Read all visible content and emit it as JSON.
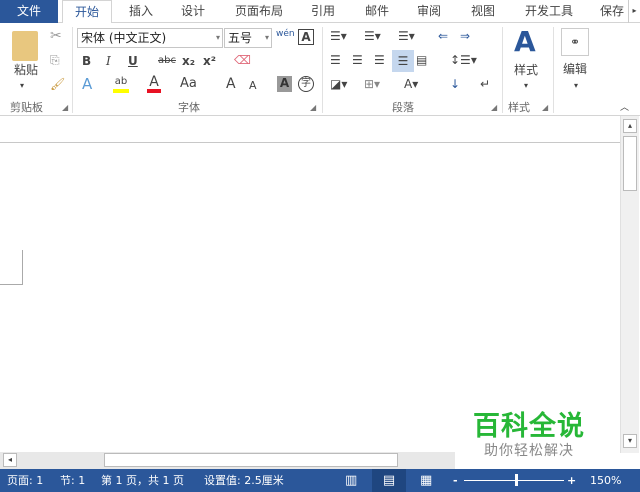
{
  "tabs": [
    "文件",
    "开始",
    "插入",
    "设计",
    "页面布局",
    "引用",
    "邮件",
    "审阅",
    "视图",
    "开发工具",
    "保存"
  ],
  "clipboard": {
    "paste": "粘贴",
    "label": "剪贴板"
  },
  "font": {
    "name": "宋体 (中文正文)",
    "size": "五号",
    "label": "字体",
    "bold": "B",
    "italic": "I",
    "underline": "U",
    "strike": "abc",
    "sub": "x₂",
    "sup": "x²",
    "case": "Aa",
    "phonetic": "wén",
    "grow": "A",
    "shrink": "A",
    "shade": "A",
    "enclose": "字"
  },
  "paragraph": {
    "label": "段落"
  },
  "styles": {
    "button": "样式",
    "label": "样式"
  },
  "editing": {
    "button": "编辑"
  },
  "status": {
    "page": "页面: 1",
    "section": "节: 1",
    "pages": "第 1 页，共 1 页",
    "setting": "设置值: 2.5厘米",
    "zoom": "150%",
    "zoom_level": 150
  },
  "watermark": {
    "title": "百科全说",
    "subtitle": "助你轻松解决"
  },
  "colors": {
    "accent": "#2b579a",
    "highlight": "#ffff00",
    "font_color": "#e81123",
    "watermark": "#27b737"
  }
}
